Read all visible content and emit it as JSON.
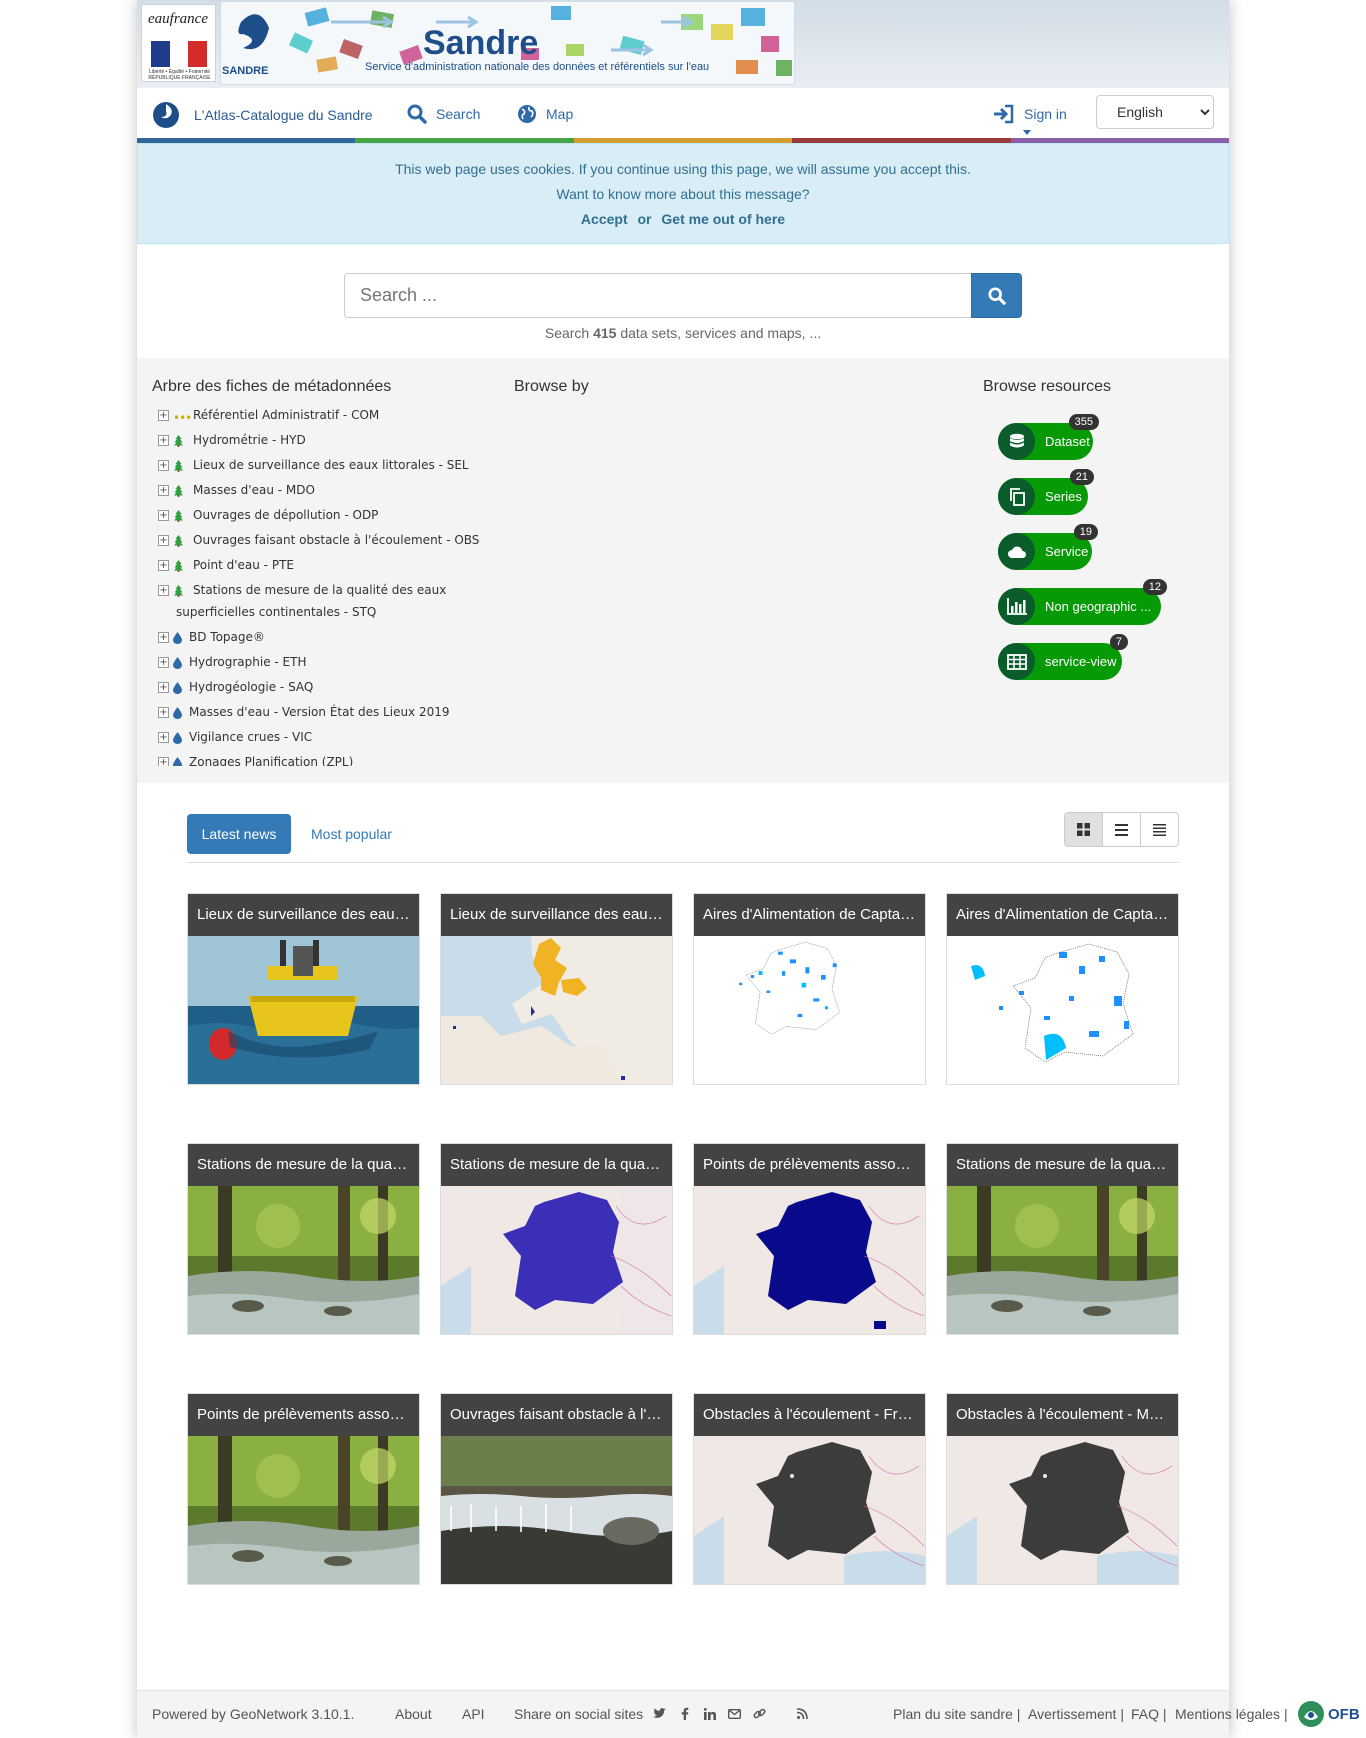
{
  "header": {
    "eaufrance_word": "eaufrance",
    "motto": "Liberté • Égalité • Fraternité RÉPUBLIQUE FRANÇAISE",
    "sandre_title": "Sandre",
    "sandre_short": "SANDRE",
    "sandre_subtitle": "Service d'administration nationale des données et référentiels sur l'eau"
  },
  "nav": {
    "brand": "L'Atlas-Catalogue du Sandre",
    "search": "Search",
    "map": "Map",
    "signin": "Sign in",
    "language": "English"
  },
  "colors": {
    "strip": [
      "#336699",
      "#47a447",
      "#d39e2f",
      "#9b3a3a",
      "#8a5ea8"
    ],
    "primary": "#337ab7",
    "resource_green": "#069a06"
  },
  "cookies": {
    "line1": "This web page uses cookies. If you continue using this page, we will assume you accept this.",
    "line2": "Want to know more about this message?",
    "accept": "Accept",
    "or": "or",
    "out": "Get me out of here"
  },
  "search": {
    "placeholder": "Search ...",
    "hint_prefix": "Search",
    "hint_count": "415",
    "hint_suffix": "data sets, services and maps, ..."
  },
  "browse": {
    "tree_title": "Arbre des fiches de métadonnées",
    "browse_by_title": "Browse by",
    "resources_title": "Browse resources",
    "tree": [
      {
        "label": "Référentiel Administratif - COM",
        "icon": "dots"
      },
      {
        "label": "Hydrométrie - HYD",
        "icon": "tree"
      },
      {
        "label": "Lieux de surveillance des eaux littorales - SEL",
        "icon": "tree"
      },
      {
        "label": "Masses d'eau - MDO",
        "icon": "tree"
      },
      {
        "label": "Ouvrages de dépollution - ODP",
        "icon": "tree"
      },
      {
        "label": "Ouvrages faisant obstacle à l'écoulement - OBS",
        "icon": "tree"
      },
      {
        "label": "Point d'eau - PTE",
        "icon": "tree"
      },
      {
        "label": "Stations de mesure de la qualité des eaux",
        "label2": "superficielles continentales - STQ",
        "icon": "tree"
      },
      {
        "label": "BD Topage®",
        "icon": "drop"
      },
      {
        "label": "Hydrographie - ETH",
        "icon": "drop"
      },
      {
        "label": "Hydrogéologie - SAQ",
        "icon": "drop"
      },
      {
        "label": "Masses d'eau - Version État des Lieux 2019",
        "icon": "drop"
      },
      {
        "label": "Vigilance crues - VIC",
        "icon": "drop"
      },
      {
        "label": "Zonages Planification (ZPL)",
        "icon": "drop"
      }
    ],
    "resources": [
      {
        "label": "Dataset",
        "count": "355",
        "icon": "database-icon"
      },
      {
        "label": "Series",
        "count": "21",
        "icon": "copy-icon"
      },
      {
        "label": "Service",
        "count": "19",
        "icon": "cloud-icon"
      },
      {
        "label": "Non geographic ...",
        "count": "12",
        "icon": "bar-chart-icon"
      },
      {
        "label": "service-view",
        "count": "7",
        "icon": "table-icon"
      }
    ]
  },
  "news": {
    "tab_latest": "Latest news",
    "tab_popular": "Most popular",
    "cards": [
      {
        "title": "Lieux de surveillance des eaux littorales",
        "thumb": "buoy"
      },
      {
        "title": "Lieux de surveillance des eaux littorales",
        "thumb": "europe-map"
      },
      {
        "title": "Aires d'Alimentation de Captages",
        "thumb": "france-dots-small"
      },
      {
        "title": "Aires d'Alimentation de Captages",
        "thumb": "france-dots"
      },
      {
        "title": "Stations de mesure de la qualité",
        "thumb": "river"
      },
      {
        "title": "Stations de mesure de la qualité",
        "thumb": "france-blue"
      },
      {
        "title": "Points de prélèvements associés",
        "thumb": "france-navy"
      },
      {
        "title": "Stations de mesure de la qualité",
        "thumb": "river"
      },
      {
        "title": "Points de prélèvements associés",
        "thumb": "river"
      },
      {
        "title": "Ouvrages faisant obstacle à l'écoulement",
        "thumb": "weir"
      },
      {
        "title": "Obstacles à l'écoulement - France",
        "thumb": "france-dark"
      },
      {
        "title": "Obstacles à l'écoulement - Métropole",
        "thumb": "france-dark"
      }
    ]
  },
  "footer": {
    "powered": "Powered by GeoNetwork 3.10.1.",
    "about": "About",
    "api": "API",
    "share": "Share on social sites",
    "plan": "Plan du site sandre |",
    "avert": "Avertissement |",
    "faq": "FAQ |",
    "mentions": "Mentions légales |",
    "ofb": "OFB"
  }
}
